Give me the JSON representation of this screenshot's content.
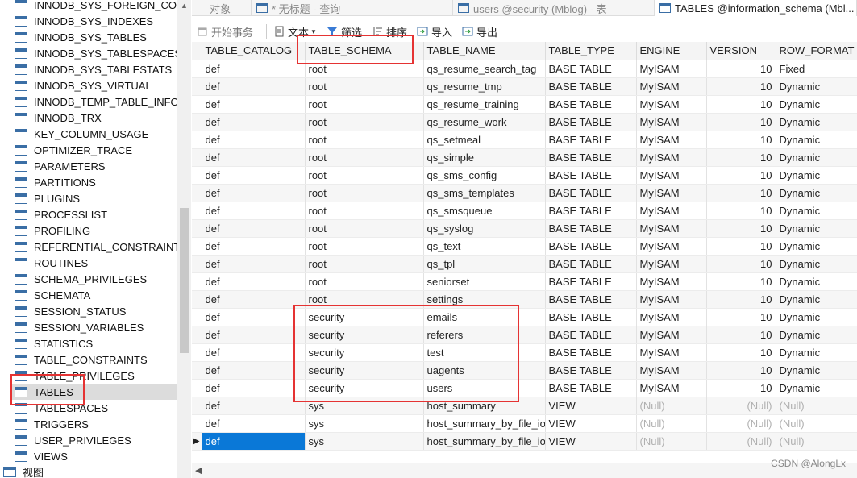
{
  "tree": {
    "items": [
      "INNODB_SYS_FOREIGN_COLS",
      "INNODB_SYS_INDEXES",
      "INNODB_SYS_TABLES",
      "INNODB_SYS_TABLESPACES",
      "INNODB_SYS_TABLESTATS",
      "INNODB_SYS_VIRTUAL",
      "INNODB_TEMP_TABLE_INFO",
      "INNODB_TRX",
      "KEY_COLUMN_USAGE",
      "OPTIMIZER_TRACE",
      "PARAMETERS",
      "PARTITIONS",
      "PLUGINS",
      "PROCESSLIST",
      "PROFILING",
      "REFERENTIAL_CONSTRAINTS",
      "ROUTINES",
      "SCHEMA_PRIVILEGES",
      "SCHEMATA",
      "SESSION_STATUS",
      "SESSION_VARIABLES",
      "STATISTICS",
      "TABLE_CONSTRAINTS",
      "TABLE_PRIVILEGES",
      "TABLES",
      "TABLESPACES",
      "TRIGGERS",
      "USER_PRIVILEGES",
      "VIEWS"
    ],
    "selected": "TABLES",
    "views_label": "视图"
  },
  "tabs": {
    "objects": "对象",
    "untitled": "* 无标题 - 查询",
    "users": "users @security (Mblog) - 表",
    "tables": "TABLES @information_schema (Mbl..."
  },
  "toolbar": {
    "begin_tx": "开始事务",
    "text": "文本",
    "filter": "筛选",
    "sort": "排序",
    "import": "导入",
    "export": "导出"
  },
  "grid": {
    "columns": [
      "TABLE_CATALOG",
      "TABLE_SCHEMA",
      "TABLE_NAME",
      "TABLE_TYPE",
      "ENGINE",
      "VERSION",
      "ROW_FORMAT"
    ],
    "rows": [
      [
        "def",
        "root",
        "qs_resume_search_tag",
        "BASE TABLE",
        "MyISAM",
        "10",
        "Fixed"
      ],
      [
        "def",
        "root",
        "qs_resume_tmp",
        "BASE TABLE",
        "MyISAM",
        "10",
        "Dynamic"
      ],
      [
        "def",
        "root",
        "qs_resume_training",
        "BASE TABLE",
        "MyISAM",
        "10",
        "Dynamic"
      ],
      [
        "def",
        "root",
        "qs_resume_work",
        "BASE TABLE",
        "MyISAM",
        "10",
        "Dynamic"
      ],
      [
        "def",
        "root",
        "qs_setmeal",
        "BASE TABLE",
        "MyISAM",
        "10",
        "Dynamic"
      ],
      [
        "def",
        "root",
        "qs_simple",
        "BASE TABLE",
        "MyISAM",
        "10",
        "Dynamic"
      ],
      [
        "def",
        "root",
        "qs_sms_config",
        "BASE TABLE",
        "MyISAM",
        "10",
        "Dynamic"
      ],
      [
        "def",
        "root",
        "qs_sms_templates",
        "BASE TABLE",
        "MyISAM",
        "10",
        "Dynamic"
      ],
      [
        "def",
        "root",
        "qs_smsqueue",
        "BASE TABLE",
        "MyISAM",
        "10",
        "Dynamic"
      ],
      [
        "def",
        "root",
        "qs_syslog",
        "BASE TABLE",
        "MyISAM",
        "10",
        "Dynamic"
      ],
      [
        "def",
        "root",
        "qs_text",
        "BASE TABLE",
        "MyISAM",
        "10",
        "Dynamic"
      ],
      [
        "def",
        "root",
        "qs_tpl",
        "BASE TABLE",
        "MyISAM",
        "10",
        "Dynamic"
      ],
      [
        "def",
        "root",
        "seniorset",
        "BASE TABLE",
        "MyISAM",
        "10",
        "Dynamic"
      ],
      [
        "def",
        "root",
        "settings",
        "BASE TABLE",
        "MyISAM",
        "10",
        "Dynamic"
      ],
      [
        "def",
        "security",
        "emails",
        "BASE TABLE",
        "MyISAM",
        "10",
        "Dynamic"
      ],
      [
        "def",
        "security",
        "referers",
        "BASE TABLE",
        "MyISAM",
        "10",
        "Dynamic"
      ],
      [
        "def",
        "security",
        "test",
        "BASE TABLE",
        "MyISAM",
        "10",
        "Dynamic"
      ],
      [
        "def",
        "security",
        "uagents",
        "BASE TABLE",
        "MyISAM",
        "10",
        "Dynamic"
      ],
      [
        "def",
        "security",
        "users",
        "BASE TABLE",
        "MyISAM",
        "10",
        "Dynamic"
      ],
      [
        "def",
        "sys",
        "host_summary",
        "VIEW",
        "(Null)",
        "(Null)",
        "(Null)"
      ],
      [
        "def",
        "sys",
        "host_summary_by_file_io",
        "VIEW",
        "(Null)",
        "(Null)",
        "(Null)"
      ],
      [
        "def",
        "sys",
        "host_summary_by_file_io_type",
        "VIEW",
        "(Null)",
        "(Null)",
        "(Null)"
      ]
    ],
    "current_row_marker": "▶"
  },
  "watermark": "CSDN @AlongLx",
  "colors": {
    "annotation": "#e53333",
    "selection": "#0a78d7",
    "icon": "#3a6ea5"
  }
}
